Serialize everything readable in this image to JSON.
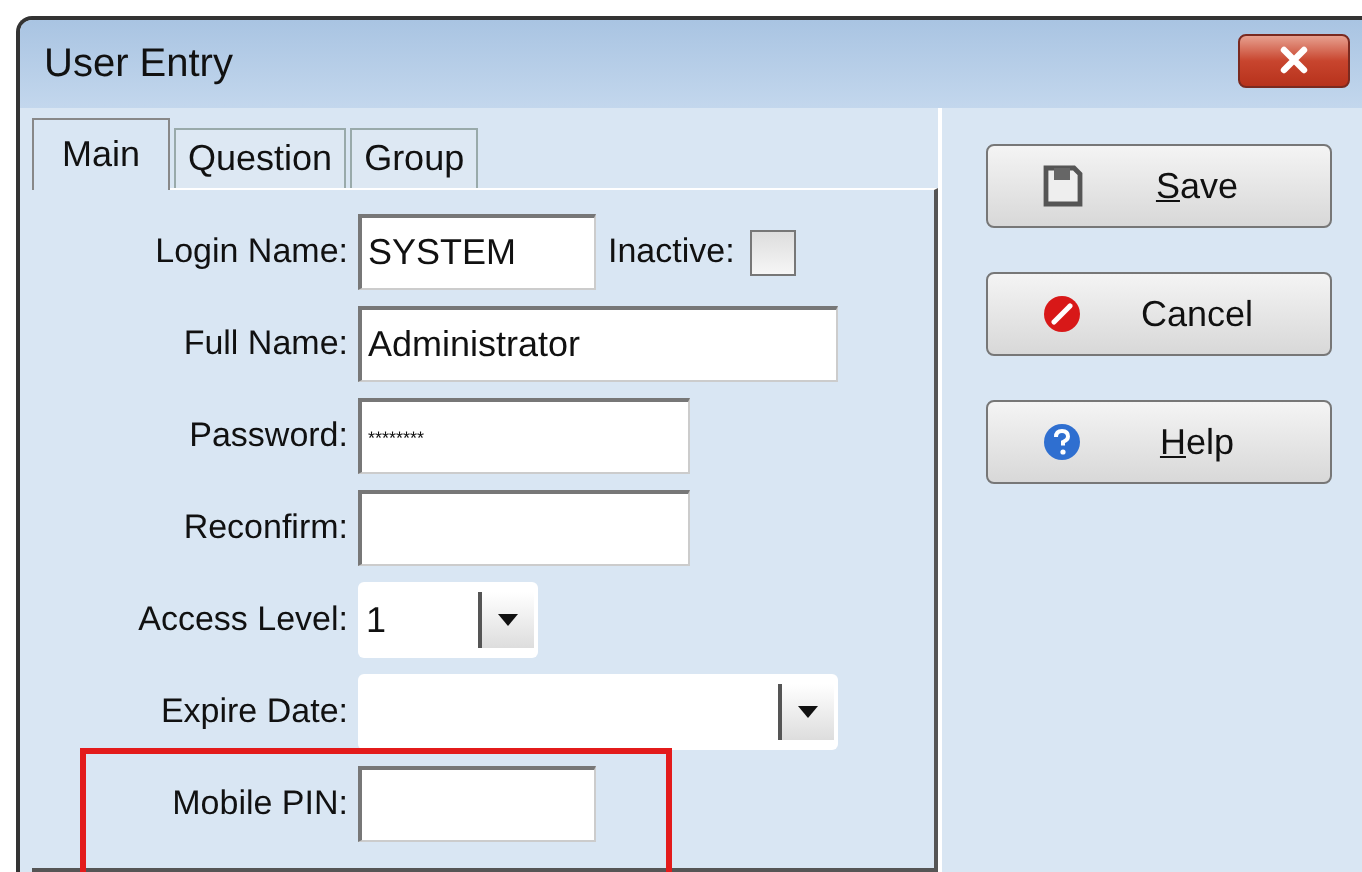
{
  "window": {
    "title": "User Entry"
  },
  "tabs": [
    {
      "label": "Main",
      "selected": true
    },
    {
      "label": "Question",
      "selected": false
    },
    {
      "label": "Group",
      "selected": false
    }
  ],
  "form": {
    "login_name": {
      "label": "Login Name:",
      "value": "SYSTEM"
    },
    "inactive": {
      "label": "Inactive:",
      "checked": false
    },
    "full_name": {
      "label": "Full Name:",
      "value": "Administrator"
    },
    "password": {
      "label": "Password:",
      "value": "********"
    },
    "reconfirm": {
      "label": "Reconfirm:"
    },
    "access_level": {
      "label": "Access Level:",
      "value": "1"
    },
    "expire_date": {
      "label": "Expire Date:"
    },
    "mobile_pin": {
      "label": "Mobile PIN:",
      "highlighted": true
    }
  },
  "buttons": [
    {
      "kind": "save",
      "label": "Save",
      "underline_first": true
    },
    {
      "kind": "cancel",
      "label": "Cancel",
      "underline_first": false
    },
    {
      "kind": "help",
      "label": "Help",
      "underline_first": true
    }
  ]
}
